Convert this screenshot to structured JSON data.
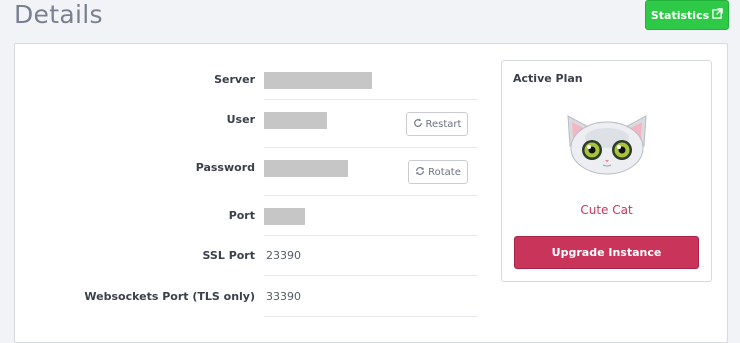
{
  "header": {
    "title": "Details",
    "statistics_label": "Statistics",
    "statistics_icon": "external-link-icon"
  },
  "details": {
    "server_label": "Server",
    "user_label": "User",
    "password_label": "Password",
    "port_label": "Port",
    "ssl_port_label": "SSL Port",
    "ssl_port_value": "23390",
    "websockets_port_label": "Websockets Port (TLS only)",
    "websockets_port_value": "33390",
    "restart_label": "Restart",
    "rotate_label": "Rotate"
  },
  "plan": {
    "title": "Active Plan",
    "name": "Cute Cat",
    "upgrade_label": "Upgrade Instance",
    "image_icon": "cat-icon"
  },
  "colors": {
    "statistics_green": "#2ec946",
    "accent_pink": "#c9355a",
    "redaction_gray": "#c6c6c6"
  }
}
